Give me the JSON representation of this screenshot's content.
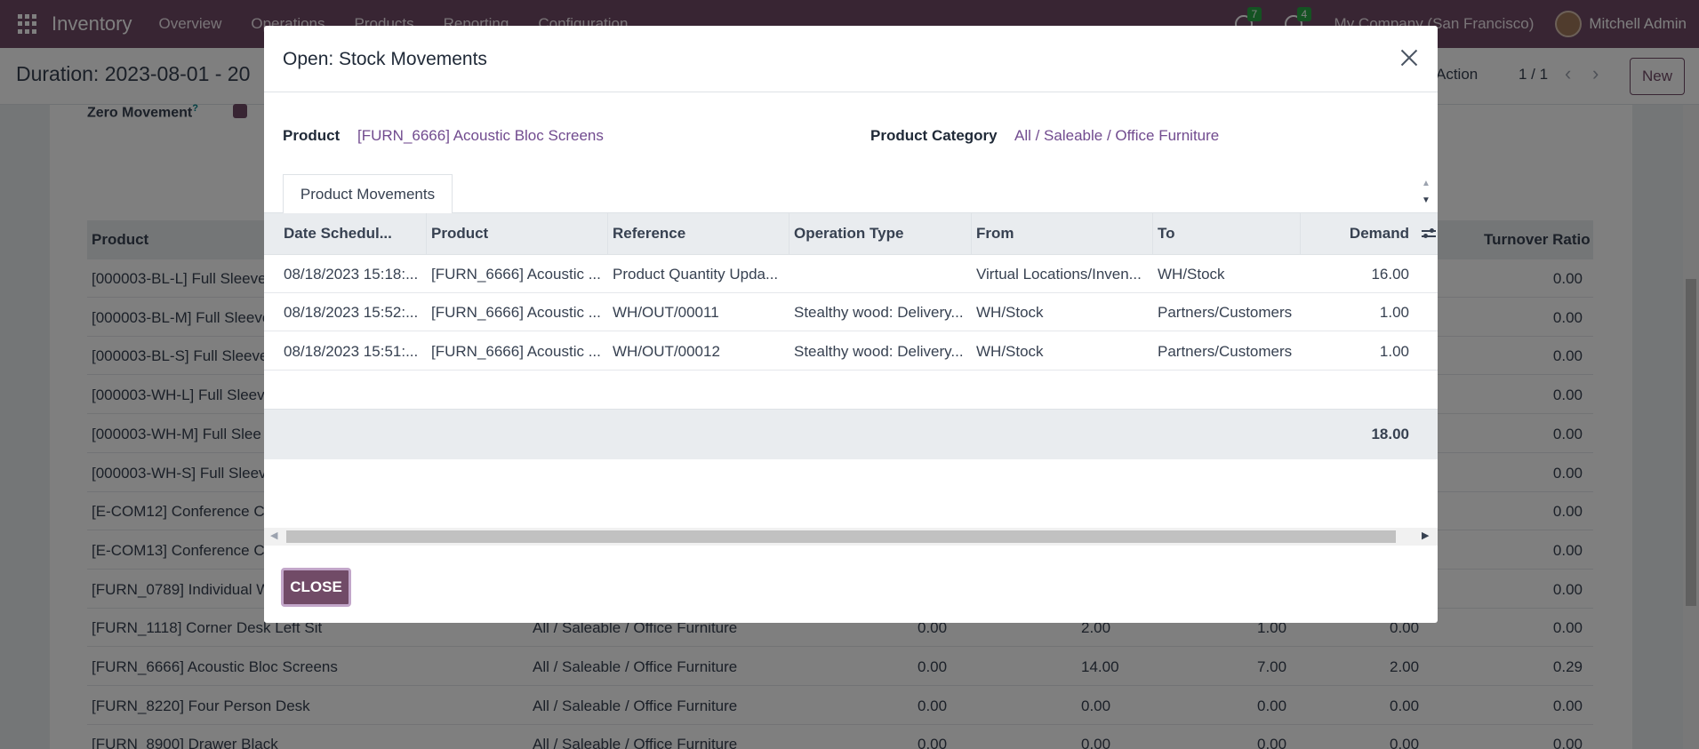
{
  "navbar": {
    "app_name": "Inventory",
    "menu": [
      "Overview",
      "Operations",
      "Products",
      "Reporting",
      "Configuration"
    ],
    "chat_badge": "7",
    "activity_badge": "4",
    "company": "My Company (San Francisco)",
    "user": "Mitchell Admin"
  },
  "control_panel": {
    "title": "Duration: 2023-08-01 - 20",
    "action_label": "Action",
    "pager": "1 / 1",
    "new_label": "New"
  },
  "background": {
    "zero_movement_label": "Zero Movement",
    "zero_movement_help": "?",
    "col_product": "Product",
    "col_turnover": "Turnover Ratio",
    "rows": [
      {
        "name": "[000003-BL-L] Full Sleeve",
        "category": "",
        "v1": "",
        "v2": "",
        "v3": "",
        "v4": "",
        "v5": "0.00"
      },
      {
        "name": "[000003-BL-M] Full Sleeve",
        "category": "",
        "v1": "",
        "v2": "",
        "v3": "",
        "v4": "",
        "v5": "0.00"
      },
      {
        "name": "[000003-BL-S] Full Sleeve",
        "category": "",
        "v1": "",
        "v2": "",
        "v3": "",
        "v4": "",
        "v5": "0.00"
      },
      {
        "name": "[000003-WH-L] Full Sleev",
        "category": "",
        "v1": "",
        "v2": "",
        "v3": "",
        "v4": "",
        "v5": "0.00"
      },
      {
        "name": "[000003-WH-M] Full Slee",
        "category": "",
        "v1": "",
        "v2": "",
        "v3": "",
        "v4": "",
        "v5": "0.00"
      },
      {
        "name": "[000003-WH-S] Full Sleev",
        "category": "",
        "v1": "",
        "v2": "",
        "v3": "",
        "v4": "",
        "v5": "0.00"
      },
      {
        "name": "[E-COM12] Conference C",
        "category": "",
        "v1": "",
        "v2": "",
        "v3": "",
        "v4": "",
        "v5": "0.00"
      },
      {
        "name": "[E-COM13] Conference C",
        "category": "",
        "v1": "",
        "v2": "",
        "v3": "",
        "v4": "",
        "v5": "0.00"
      },
      {
        "name": "[FURN_0789] Individual W",
        "category": "",
        "v1": "",
        "v2": "",
        "v3": "",
        "v4": "",
        "v5": "0.00"
      },
      {
        "name": "[FURN_1118] Corner Desk Left Sit",
        "category": "All / Saleable / Office Furniture",
        "v1": "0.00",
        "v2": "2.00",
        "v3": "1.00",
        "v4": "0.00",
        "v5": "0.00"
      },
      {
        "name": "[FURN_6666] Acoustic Bloc Screens",
        "category": "All / Saleable / Office Furniture",
        "v1": "0.00",
        "v2": "14.00",
        "v3": "7.00",
        "v4": "2.00",
        "v5": "0.29"
      },
      {
        "name": "[FURN_8220] Four Person Desk",
        "category": "All / Saleable / Office Furniture",
        "v1": "0.00",
        "v2": "0.00",
        "v3": "0.00",
        "v4": "0.00",
        "v5": "0.00"
      },
      {
        "name": "[FURN_8900] Drawer Black",
        "category": "All / Saleable / Office Furniture",
        "v1": "0.00",
        "v2": "0.00",
        "v3": "0.00",
        "v4": "0.00",
        "v5": "0.00"
      }
    ]
  },
  "modal": {
    "title": "Open: Stock Movements",
    "product_label": "Product",
    "product_value": "[FURN_6666] Acoustic Bloc Screens",
    "category_label": "Product Category",
    "category_value": "All / Saleable / Office Furniture",
    "tab_label": "Product Movements",
    "columns": [
      "Date Schedul...",
      "Product",
      "Reference",
      "Operation Type",
      "From",
      "To",
      "Demand"
    ],
    "rows": [
      {
        "date": "08/18/2023 15:18:...",
        "product": "[FURN_6666] Acoustic ...",
        "reference": "Product Quantity Upda...",
        "operation": "",
        "from": "Virtual Locations/Inven...",
        "to": "WH/Stock",
        "demand": "16.00"
      },
      {
        "date": "08/18/2023 15:52:...",
        "product": "[FURN_6666] Acoustic ...",
        "reference": "WH/OUT/00011",
        "operation": "Stealthy wood: Delivery...",
        "from": "WH/Stock",
        "to": "Partners/Customers",
        "demand": "1.00"
      },
      {
        "date": "08/18/2023 15:51:...",
        "product": "[FURN_6666] Acoustic ...",
        "reference": "WH/OUT/00012",
        "operation": "Stealthy wood: Delivery...",
        "from": "WH/Stock",
        "to": "Partners/Customers",
        "demand": "1.00"
      }
    ],
    "total_demand": "18.00",
    "close_button": "CLOSE"
  },
  "colors": {
    "brand": "#714b67",
    "link": "#714b8f"
  }
}
